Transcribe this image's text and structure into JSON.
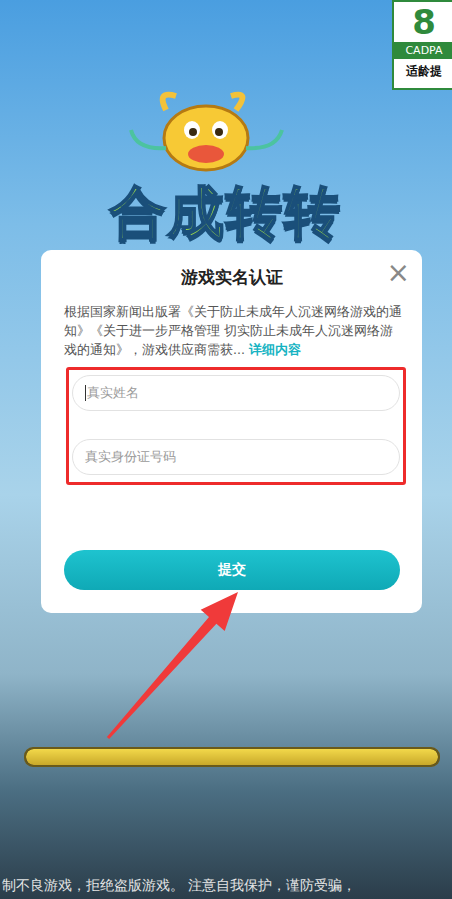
{
  "rating_badge": {
    "age": "8",
    "org": "CADPA",
    "label": "适龄提"
  },
  "game_title": "合成转转",
  "dialog": {
    "title": "游戏实名认证",
    "close": "×",
    "notice": "根据国家新闻出版署《关于防止未成年人沉迷网络游戏的通知》《关于进一步严格管理 切实防止未成年人沉迷网络游戏的通知》，游戏供应商需获...",
    "link": "详细内容",
    "fields": [
      {
        "placeholder": "真实姓名",
        "focused": true
      },
      {
        "placeholder": "真实身份证号码",
        "focused": false
      }
    ],
    "submit": "提交"
  },
  "loading_bar": {
    "level": 1
  },
  "footer_notice": "制不良游戏，拒绝盗版游戏。 注意自我保护，谨防受骗，"
}
